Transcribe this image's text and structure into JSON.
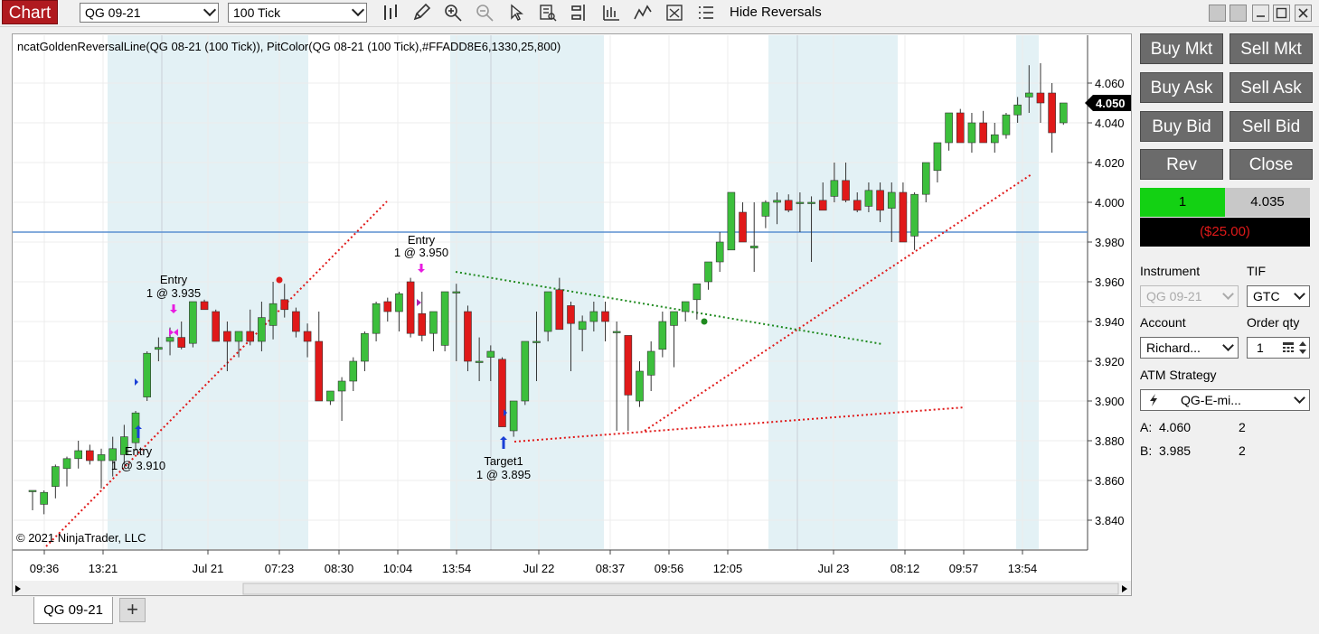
{
  "toolbar": {
    "chart_tab": "Chart",
    "instrument": "QG 09-21",
    "interval": "100 Tick",
    "hide_reversals": "Hide Reversals"
  },
  "chart": {
    "indicator_label": "ncatGoldenReversalLine(QG 08-21 (100 Tick)), PitColor(QG 08-21 (100 Tick),#FFADD8E6,1330,25,800)",
    "copyright": "© 2021 NinjaTrader, LLC",
    "price_axis": [
      "4.060",
      "4.040",
      "4.020",
      "4.000",
      "3.980",
      "3.960",
      "3.940",
      "3.920",
      "3.900",
      "3.880",
      "3.860",
      "3.840"
    ],
    "last_price": "4.050",
    "time_axis": [
      "09:36",
      "13:21",
      "Jul 21",
      "07:23",
      "08:30",
      "10:04",
      "13:54",
      "Jul 22",
      "08:37",
      "09:56",
      "12:05",
      "Jul 23",
      "08:12",
      "09:57",
      "13:54"
    ],
    "annotations": [
      {
        "title": "Entry",
        "detail": "1 @ 3.935"
      },
      {
        "title": "Entry",
        "detail": "1 @ 3.950"
      },
      {
        "title": "Entry",
        "detail": "1 @ 3.910"
      },
      {
        "title": "Target1",
        "detail": "1 @ 3.895"
      }
    ],
    "colors": {
      "up": "#3cbf3c",
      "down": "#e01919",
      "session": "#e3f1f5",
      "hline": "#5b8fd1",
      "red_trend": "#e01919",
      "green_trend": "#1f8a1f"
    }
  },
  "panel": {
    "buttons": {
      "buy_mkt": "Buy Mkt",
      "sell_mkt": "Sell Mkt",
      "buy_ask": "Buy Ask",
      "sell_ask": "Sell Ask",
      "buy_bid": "Buy Bid",
      "sell_bid": "Sell Bid",
      "rev": "Rev",
      "close": "Close"
    },
    "position_qty": "1",
    "position_price": "4.035",
    "pnl": "($25.00)",
    "instrument_label": "Instrument",
    "instrument_value": "QG 09-21",
    "tif_label": "TIF",
    "tif_value": "GTC",
    "account_label": "Account",
    "account_value": "Richard...",
    "order_qty_label": "Order qty",
    "order_qty_value": "1",
    "atm_label": "ATM Strategy",
    "atm_value": "QG-E-mi...",
    "ask_label": "A:",
    "ask_price": "4.060",
    "ask_size": "2",
    "bid_label": "B:",
    "bid_price": "3.985",
    "bid_size": "2"
  },
  "tabs": {
    "active": "QG 09-21",
    "add": "+"
  }
}
